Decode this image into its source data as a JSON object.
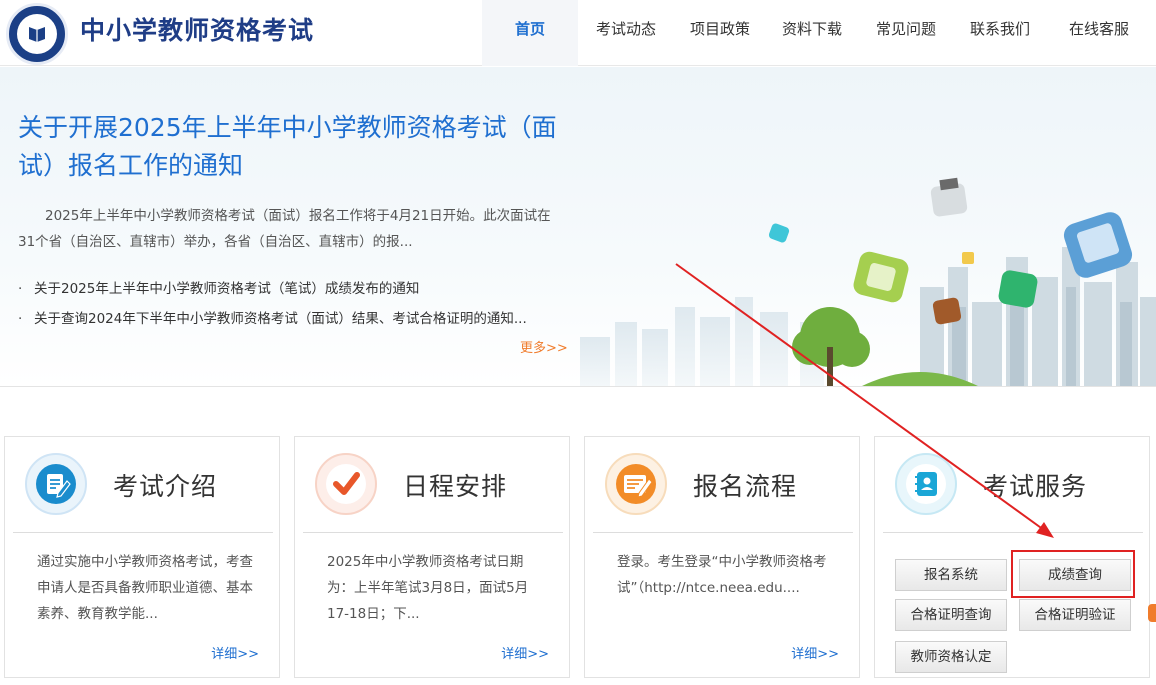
{
  "header": {
    "site_title": "中小学教师资格考试",
    "nav": [
      "首页",
      "考试动态",
      "项目政策",
      "资料下载",
      "常见问题",
      "联系我们",
      "在线客服"
    ]
  },
  "hero": {
    "title": "关于开展2025年上半年中小学教师资格考试（面试）报名工作的通知",
    "summary": "2025年上半年中小学教师资格考试（面试）报名工作将于4月21日开始。此次面试在31个省（自治区、直辖市）举办，各省（自治区、直辖市）的报...",
    "links": [
      "关于2025年上半年中小学教师资格考试（笔试）成绩发布的通知",
      "关于查询2024年下半年中小学教师资格考试（面试）结果、考试合格证明的通知..."
    ],
    "more": "更多>>",
    "bullet": "·"
  },
  "cards": [
    {
      "title": "考试介绍",
      "body": "通过实施中小学教师资格考试，考查申请人是否具备教师职业道德、基本素养、教育教学能...",
      "detail": "详细>>",
      "icon": "document-edit-icon"
    },
    {
      "title": "日程安排",
      "body": "2025年中小学教师资格考试日期为：上半年笔试3月8日，面试5月17-18日；下...",
      "detail": "详细>>",
      "icon": "checkmark-icon"
    },
    {
      "title": "报名流程",
      "body": "登录。考生登录“中小学教师资格考试”（http://ntce.neea.edu....",
      "detail": "详细>>",
      "icon": "form-pen-icon"
    },
    {
      "title": "考试服务",
      "icon": "contacts-book-icon"
    }
  ],
  "services": [
    "报名系统",
    "成绩查询",
    "合格证明查询",
    "合格证明验证",
    "教师资格认定"
  ],
  "colors": {
    "brand": "#1f3d86",
    "link": "#1f6fd0",
    "accent": "#f07c2c",
    "highlight": "#e02222"
  }
}
